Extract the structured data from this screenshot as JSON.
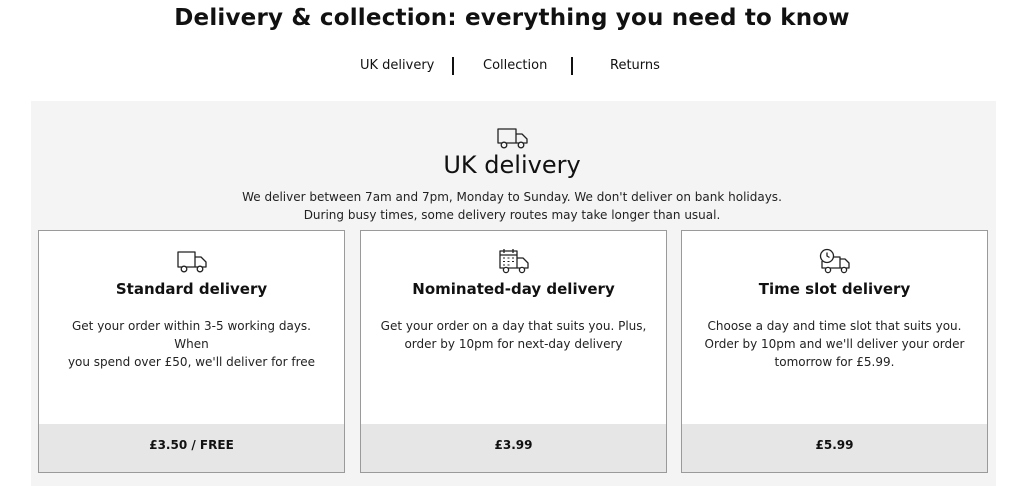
{
  "page": {
    "title": "Delivery & collection: everything you need to know"
  },
  "subnav": {
    "items": [
      {
        "label": "UK delivery"
      },
      {
        "label": "Collection"
      },
      {
        "label": "Returns"
      }
    ]
  },
  "section": {
    "icon": "delivery-van-icon",
    "title": "UK delivery",
    "description_lines": [
      "We deliver between 7am and 7pm, Monday to Sunday. We don't deliver on bank holidays.",
      "During busy times, some delivery routes may take longer than usual."
    ]
  },
  "cards": [
    {
      "icon": "delivery-van-icon",
      "title": "Standard delivery",
      "description_lines": [
        "Get your order within 3-5 working days. When",
        "you spend over £50, we'll deliver for free"
      ],
      "price": "£3.50 / FREE"
    },
    {
      "icon": "calendar-van-icon",
      "title": "Nominated-day delivery",
      "description_lines": [
        "Get your order on a day that suits you. Plus,",
        "order by 10pm for next-day delivery"
      ],
      "price": "£3.99"
    },
    {
      "icon": "clock-van-icon",
      "title": "Time slot delivery",
      "description_lines": [
        "Choose a day and time slot that suits you.",
        "Order by 10pm and we'll deliver your order",
        "tomorrow for £5.99."
      ],
      "price": "£5.99"
    }
  ]
}
